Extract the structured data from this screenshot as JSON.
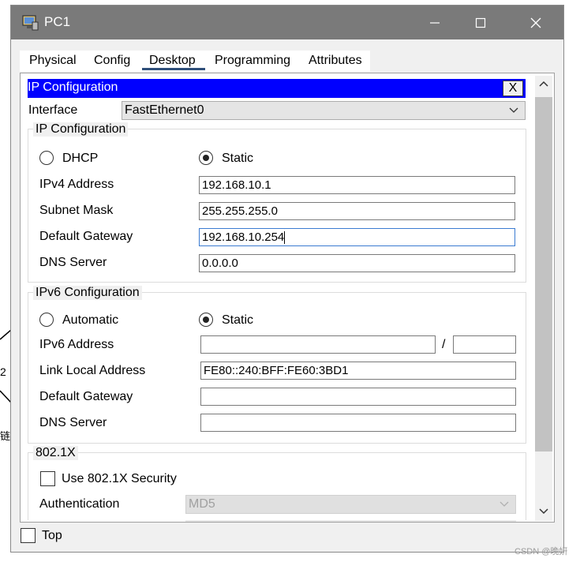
{
  "window": {
    "title": "PC1"
  },
  "tabs": [
    {
      "label": "Physical"
    },
    {
      "label": "Config"
    },
    {
      "label": "Desktop"
    },
    {
      "label": "Programming"
    },
    {
      "label": "Attributes"
    }
  ],
  "ip_config": {
    "header_title": "IP Configuration",
    "close_label": "X",
    "interface_label": "Interface",
    "interface_value": "FastEthernet0",
    "ipv4": {
      "group_title": "IP Configuration",
      "dhcp_label": "DHCP",
      "static_label": "Static",
      "selected": "Static",
      "fields": {
        "ipv4_address_label": "IPv4 Address",
        "ipv4_address_value": "192.168.10.1",
        "subnet_mask_label": "Subnet Mask",
        "subnet_mask_value": "255.255.255.0",
        "default_gateway_label": "Default Gateway",
        "default_gateway_value": "192.168.10.254",
        "dns_server_label": "DNS Server",
        "dns_server_value": "0.0.0.0"
      }
    },
    "ipv6": {
      "group_title": "IPv6 Configuration",
      "automatic_label": "Automatic",
      "static_label": "Static",
      "selected": "Static",
      "fields": {
        "ipv6_address_label": "IPv6 Address",
        "ipv6_address_value": "",
        "prefix_separator": "/",
        "prefix_value": "",
        "link_local_label": "Link Local Address",
        "link_local_value": "FE80::240:BFF:FE60:3BD1",
        "default_gateway_label": "Default Gateway",
        "default_gateway_value": "",
        "dns_server_label": "DNS Server",
        "dns_server_value": ""
      }
    },
    "dot1x": {
      "group_title": "802.1X",
      "use_security_label": "Use 802.1X Security",
      "use_security_checked": false,
      "authentication_label": "Authentication",
      "authentication_value": "MD5"
    }
  },
  "footer": {
    "top_label": "Top",
    "top_checked": false
  },
  "background": {
    "fragment_1": "2",
    "fragment_2": "链路"
  },
  "watermark": "CSDN @晚妍",
  "colors": {
    "titlebar": "#7a7a7a",
    "header_blue": "#0000ff",
    "tab_underline": "#2f4f7a"
  }
}
